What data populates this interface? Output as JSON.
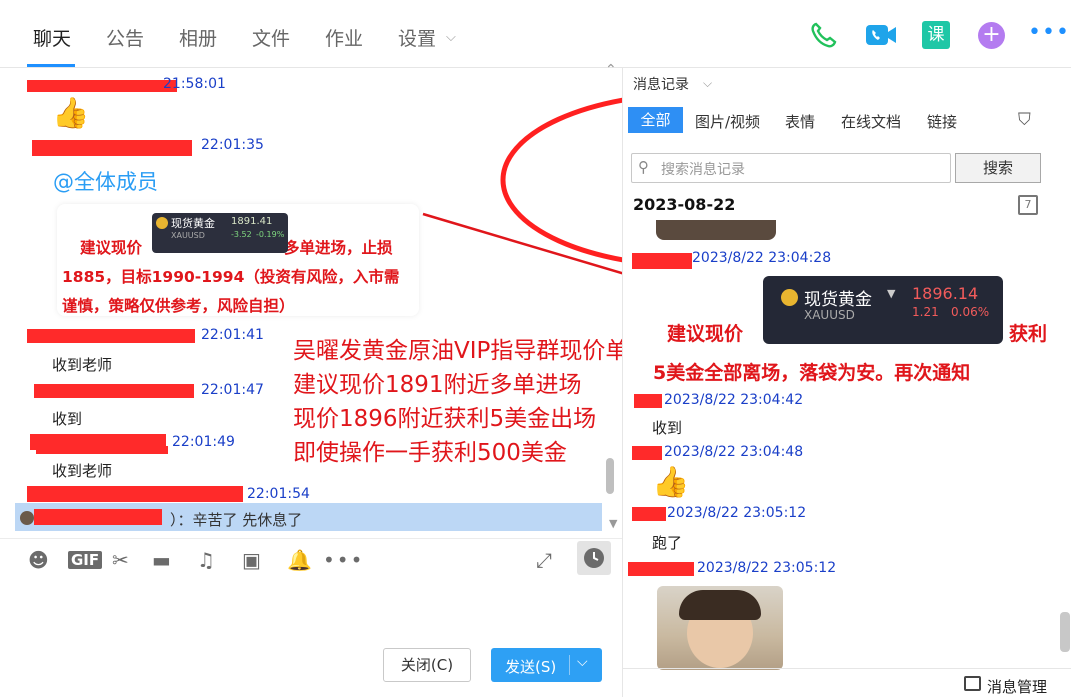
{
  "nav": {
    "tabs": [
      "聊天",
      "公告",
      "相册",
      "文件",
      "作业",
      "设置"
    ],
    "active_index": 0,
    "icon_colors": {
      "phone": "#21c15b",
      "video": "#1fa4ea",
      "course": "#1ec7a6",
      "add": "#b47cf0"
    }
  },
  "chat": {
    "entries": [
      {
        "time": "21:58:01"
      },
      {
        "time": "22:01:35",
        "at_all": "@全体成员"
      },
      {
        "time": "22:01:41",
        "text": "收到老师"
      },
      {
        "time": "22:01:47",
        "text": "收到"
      },
      {
        "time": "22:01:49",
        "text": "收到老师"
      },
      {
        "time": "22:01:54"
      }
    ],
    "card": {
      "text_a": "建议现价",
      "text_b": "多单进场，止损1885，目标1990-1994（投资有风险，入市需谨慎，策略仅供参考，风险自担）",
      "quote_name": "现货黄金",
      "quote_price": "1891.41",
      "quote_symbol": "XAUUSD",
      "quote_change": "-3.52",
      "quote_pct": "-0.19%"
    },
    "overlay_lines": [
      "吴曜发黄金原油VIP指导群现价单",
      "建议现价1891附近多单进场",
      "现价1896附近获利5美金出场",
      "即使操作一手获利500美金"
    ],
    "quoted_reply": "）：辛苦了  先休息了"
  },
  "toolbar": {
    "close_label": "关闭(C)",
    "send_label": "发送(S)"
  },
  "right": {
    "header": "消息记录",
    "tabs": [
      "全部",
      "图片/视频",
      "表情",
      "在线文档",
      "链接"
    ],
    "search_placeholder": "搜索消息记录",
    "search_button": "搜索",
    "date": "2023-08-22",
    "messages": [
      {
        "time": "2023/8/22 23:04:28"
      },
      {
        "time": "2023/8/22 23:04:42",
        "text": "收到"
      },
      {
        "time": "2023/8/22 23:04:48"
      },
      {
        "time": "2023/8/22 23:05:12",
        "text": "跑了"
      },
      {
        "time": "2023/8/22 23:05:12"
      }
    ],
    "quote": {
      "name": "现货黄金",
      "price": "1896.14",
      "symbol": "XAUUSD",
      "change": "1.21",
      "pct": "0.06%"
    },
    "red_a": "建议现价",
    "red_b": "获利",
    "red_line2": "5美金全部离场，落袋为安。再次通知",
    "footer": "消息管理"
  }
}
